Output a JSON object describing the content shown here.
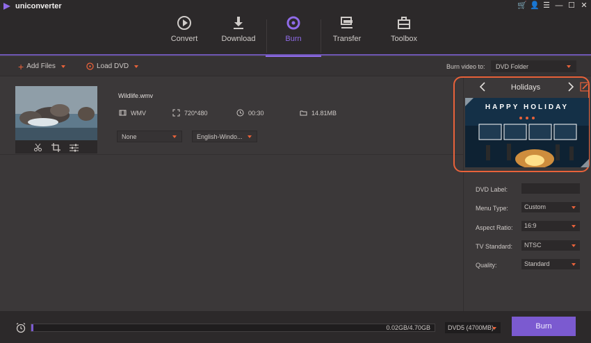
{
  "app": {
    "title": "uniconverter"
  },
  "window_controls": [
    "cart-icon",
    "account-icon",
    "menu-icon",
    "minimize-icon",
    "maximize-icon",
    "close-icon"
  ],
  "tabs": [
    {
      "label": "Convert",
      "icon": "convert-icon",
      "active": false
    },
    {
      "label": "Download",
      "icon": "download-icon",
      "active": false
    },
    {
      "label": "Burn",
      "icon": "burn-icon",
      "active": true
    },
    {
      "label": "Transfer",
      "icon": "transfer-icon",
      "active": false
    },
    {
      "label": "Toolbox",
      "icon": "toolbox-icon",
      "active": false
    }
  ],
  "toolbar": {
    "add_files": "Add Files",
    "load_dvd": "Load DVD",
    "burn_to_label": "Burn video to:",
    "burn_to_value": "DVD Folder"
  },
  "file": {
    "name": "Wildlife.wmv",
    "format": "WMV",
    "resolution": "720*480",
    "duration": "00:30",
    "size": "14.81MB",
    "subtitle": "None",
    "audio": "English-Windo..."
  },
  "template": {
    "name": "Holidays",
    "preview_title": "HAPPY HOLIDAY"
  },
  "settings": {
    "dvd_label": {
      "label": "DVD Label:",
      "value": ""
    },
    "menu_type": {
      "label": "Menu Type:",
      "value": "Custom"
    },
    "aspect_ratio": {
      "label": "Aspect Ratio:",
      "value": "16:9"
    },
    "tv_standard": {
      "label": "TV Standard:",
      "value": "NTSC"
    },
    "quality": {
      "label": "Quality:",
      "value": "Standard"
    }
  },
  "bottom": {
    "progress_text": "0.02GB/4.70GB",
    "progress_fraction": 0.004,
    "disc_type": "DVD5 (4700MB)",
    "burn_button": "Burn"
  },
  "colors": {
    "accent": "#7b5ad0",
    "highlight": "#e9623a",
    "background": "#3b3839"
  }
}
